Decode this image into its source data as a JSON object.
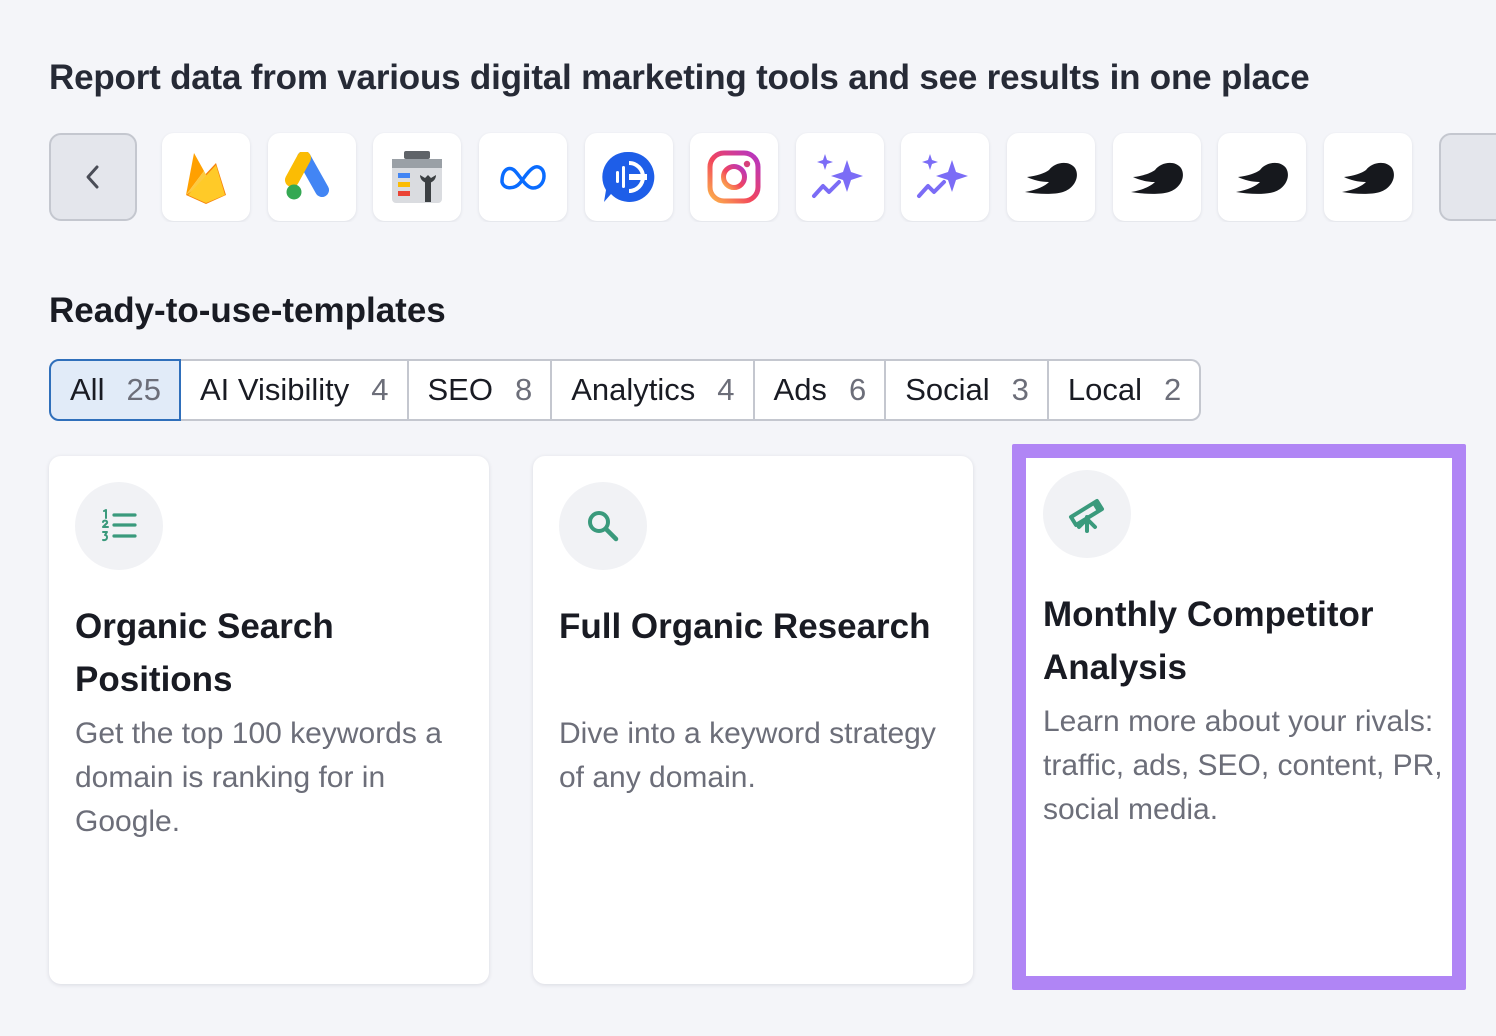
{
  "heading": "Report data from various digital marketing tools and see results in one place",
  "tools": {
    "prev_icon": "chevron-left-icon",
    "next_icon": "chevron-right-icon",
    "items": [
      {
        "icon": "firebase-icon"
      },
      {
        "icon": "google-ads-icon"
      },
      {
        "icon": "search-console-icon"
      },
      {
        "icon": "meta-icon"
      },
      {
        "icon": "call-tracking-icon"
      },
      {
        "icon": "instagram-icon"
      },
      {
        "icon": "ai-sparkle-icon"
      },
      {
        "icon": "ai-sparkle-icon"
      },
      {
        "icon": "semrush-icon"
      },
      {
        "icon": "semrush-icon"
      },
      {
        "icon": "semrush-icon"
      },
      {
        "icon": "semrush-icon"
      }
    ]
  },
  "templates": {
    "title": "Ready-to-use-templates",
    "tabs": [
      {
        "label": "All",
        "count": "25",
        "active": true
      },
      {
        "label": "AI Visibility",
        "count": "4"
      },
      {
        "label": "SEO",
        "count": "8"
      },
      {
        "label": "Analytics",
        "count": "4"
      },
      {
        "label": "Ads",
        "count": "6"
      },
      {
        "label": "Social",
        "count": "3"
      },
      {
        "label": "Local",
        "count": "2"
      }
    ],
    "cards": [
      {
        "icon": "numbered-list-icon",
        "title": "Organic Search Positions",
        "description": "Get the top 100 keywords a domain is ranking for in Google."
      },
      {
        "icon": "search-icon",
        "title": "Full Organic Research",
        "description": "Dive into a keyword strategy of any domain."
      },
      {
        "icon": "telescope-icon",
        "title": "Monthly Competitor Analysis",
        "description": "Learn more about your rivals: traffic, ads, SEO, content, PR, social media.",
        "highlighted": true
      }
    ]
  },
  "colors": {
    "background": "#f4f5f9",
    "active_tab_bg": "#e1ebf8",
    "active_tab_border": "#2f6fbb",
    "highlight_border": "#b085f5",
    "icon_green": "#3a9a7c"
  }
}
